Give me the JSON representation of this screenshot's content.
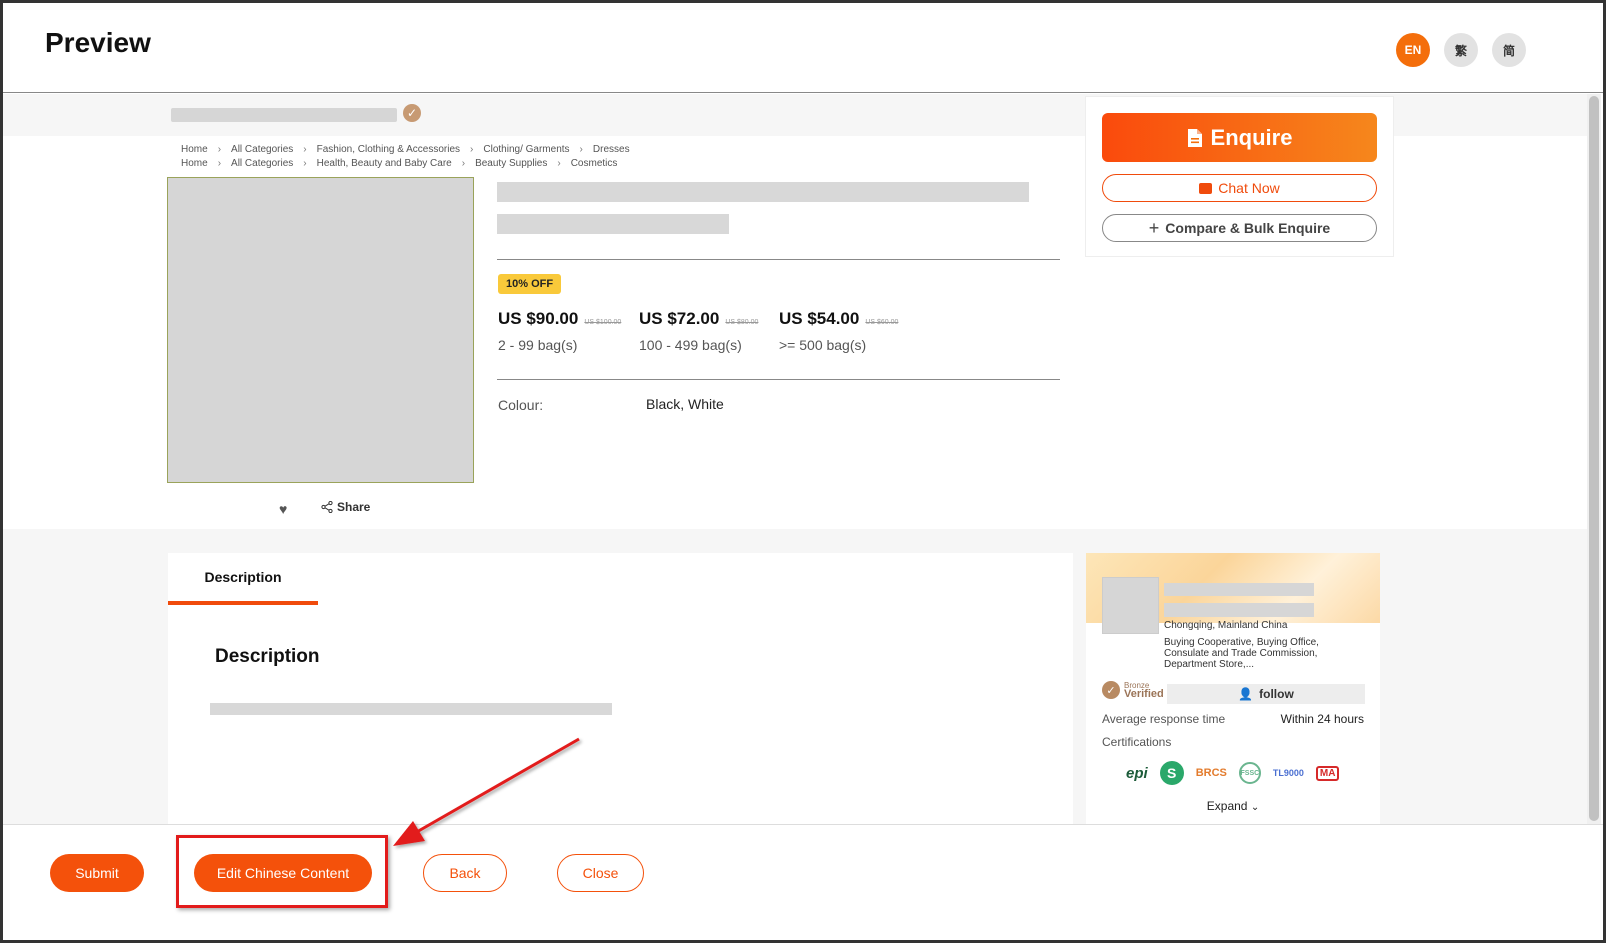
{
  "header": {
    "title": "Preview",
    "languages": [
      "EN",
      "繁",
      "简"
    ]
  },
  "breadcrumbs": [
    [
      "Home",
      "All Categories",
      "Fashion, Clothing & Accessories",
      "Clothing/ Garments",
      "Dresses"
    ],
    [
      "Home",
      "All Categories",
      "Health, Beauty and Baby Care",
      "Beauty Supplies",
      "Cosmetics"
    ]
  ],
  "product": {
    "discount_badge": "10% OFF",
    "prices": [
      {
        "price": "US $90.00",
        "original": "US $100.00",
        "qty": "2 - 99 bag(s)"
      },
      {
        "price": "US $72.00",
        "original": "US $80.00",
        "qty": "100 - 499 bag(s)"
      },
      {
        "price": "US $54.00",
        "original": "US $60.00",
        "qty": ">= 500 bag(s)"
      }
    ],
    "colour_label": "Colour:",
    "colour_value": "Black, White",
    "share_label": "Share"
  },
  "actions": {
    "enquire": "Enquire",
    "chat": "Chat Now",
    "compare": "Compare & Bulk Enquire"
  },
  "description": {
    "tab_label": "Description",
    "heading": "Description"
  },
  "company": {
    "location": "Chongqing, Mainland China",
    "business_type": "Buying Cooperative, Buying Office, Consulate and Trade Commission, Department Store,...",
    "badge_small": "Bronze",
    "badge_big": "Verified",
    "follow": "follow",
    "response_label": "Average response time",
    "response_value": "Within 24 hours",
    "certifications_label": "Certifications",
    "certs": [
      "epi",
      "S",
      "BRCS",
      "FSSC",
      "TL9000",
      "MA"
    ],
    "expand": "Expand"
  },
  "footer": {
    "submit": "Submit",
    "edit_chinese": "Edit Chinese Content",
    "back": "Back",
    "close": "Close"
  },
  "colors": {
    "accent": "#f4510b",
    "annotation": "#e21b1b"
  }
}
